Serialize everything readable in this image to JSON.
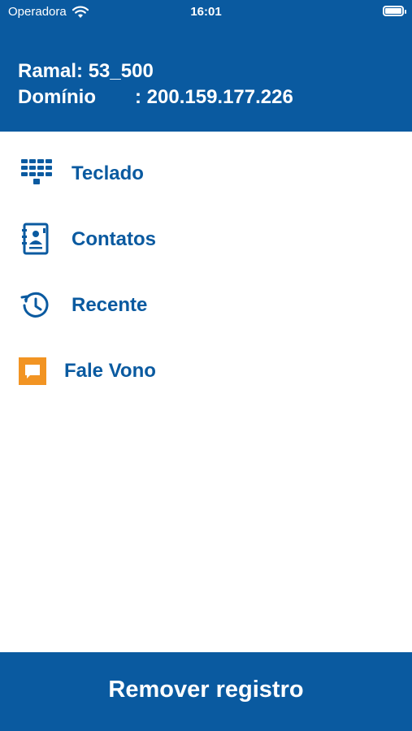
{
  "status_bar": {
    "carrier": "Operadora",
    "time": "16:01",
    "wifi_icon": "wifi-icon",
    "battery_icon": "battery-icon"
  },
  "header": {
    "ramal_label": "Ramal:",
    "ramal_value": "53_500",
    "dominio_label": "Domínio",
    "dominio_value": ": 200.159.177.226"
  },
  "menu": {
    "items": [
      {
        "label": "Teclado",
        "icon": "keypad-icon"
      },
      {
        "label": "Contatos",
        "icon": "contacts-book-icon"
      },
      {
        "label": "Recente",
        "icon": "history-clock-icon"
      },
      {
        "label": "Fale Vono",
        "icon": "chat-bubble-icon"
      }
    ]
  },
  "footer": {
    "button_label": "Remover registro"
  },
  "colors": {
    "primary": "#0a5aa0",
    "accent_orange": "#f29423",
    "background": "#ffffff"
  }
}
